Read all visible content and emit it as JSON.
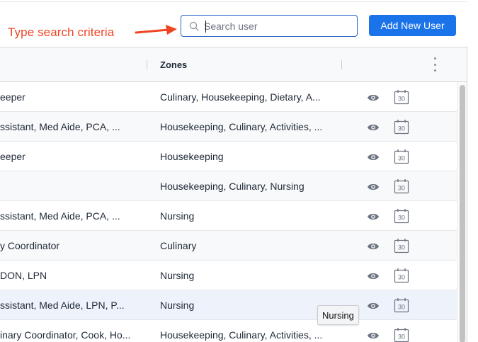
{
  "annotation": {
    "text": "Type search criteria",
    "color": "#ef4423"
  },
  "search": {
    "placeholder": "Search user",
    "value": ""
  },
  "toolbar": {
    "add_label": "Add New User",
    "accent": "#1a73e8"
  },
  "grid": {
    "header": {
      "zones_label": "Zones"
    },
    "rows": [
      {
        "role": "eeper",
        "zones": "Culinary, Housekeeping, Dietary, A..."
      },
      {
        "role": "ssistant, Med Aide, PCA, ...",
        "zones": "Housekeeping, Culinary, Activities, ..."
      },
      {
        "role": "eeper",
        "zones": "Housekeeping"
      },
      {
        "role": "",
        "zones": "Housekeeping, Culinary, Nursing"
      },
      {
        "role": "ssistant, Med Aide, PCA, ...",
        "zones": "Nursing"
      },
      {
        "role": "y Coordinator",
        "zones": "Culinary"
      },
      {
        "role": " DON, LPN",
        "zones": "Nursing"
      },
      {
        "role": "ssistant, Med Aide, LPN, P...",
        "zones": "Nursing"
      },
      {
        "role": "inary Coordinator, Cook, Ho...",
        "zones": "Housekeeping, Culinary, Activities, ..."
      }
    ],
    "calendar_icon_text": "30"
  },
  "tooltip": {
    "text": "Nursing"
  }
}
